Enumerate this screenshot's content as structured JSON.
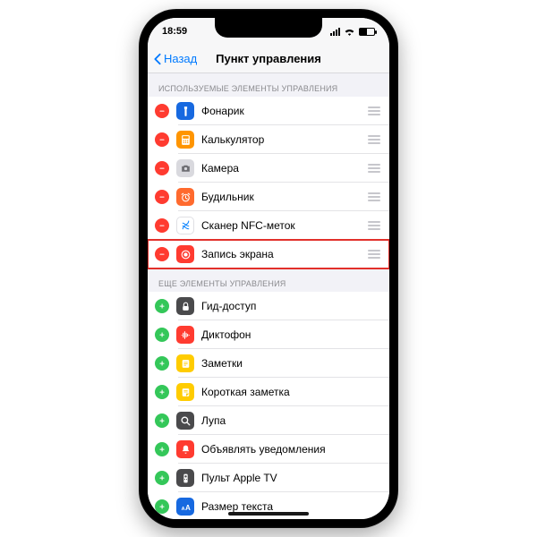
{
  "status": {
    "time": "18:59"
  },
  "nav": {
    "back": "Назад",
    "title": "Пункт управления"
  },
  "section_included": "ИСПОЛЬЗУЕМЫЕ ЭЛЕМЕНТЫ УПРАВЛЕНИЯ",
  "section_more": "ЕЩЕ ЭЛЕМЕНТЫ УПРАВЛЕНИЯ",
  "included": [
    {
      "label": "Фонарик",
      "icon_bg": "#1769e0",
      "glyph": "flashlight"
    },
    {
      "label": "Калькулятор",
      "icon_bg": "#ff9500",
      "glyph": "calculator"
    },
    {
      "label": "Камера",
      "icon_bg": "#d9d9de",
      "glyph": "camera"
    },
    {
      "label": "Будильник",
      "icon_bg": "#ff6a2e",
      "glyph": "alarm"
    },
    {
      "label": "Сканер NFC-меток",
      "icon_bg": "#ffffff",
      "glyph": "nfc"
    },
    {
      "label": "Запись экрана",
      "icon_bg": "#ff3b30",
      "glyph": "record",
      "highlight": true
    }
  ],
  "more": [
    {
      "label": "Гид-доступ",
      "icon_bg": "#4a4a4c",
      "glyph": "lock"
    },
    {
      "label": "Диктофон",
      "icon_bg": "#ff3b30",
      "glyph": "wave"
    },
    {
      "label": "Заметки",
      "icon_bg": "#ffcc00",
      "glyph": "note"
    },
    {
      "label": "Короткая заметка",
      "icon_bg": "#ffcc00",
      "glyph": "quicknote"
    },
    {
      "label": "Лупа",
      "icon_bg": "#4a4a4c",
      "glyph": "magnifier"
    },
    {
      "label": "Объявлять уведомления",
      "icon_bg": "#ff3b30",
      "glyph": "bell"
    },
    {
      "label": "Пульт Apple TV",
      "icon_bg": "#4a4a4c",
      "glyph": "remote"
    },
    {
      "label": "Размер текста",
      "icon_bg": "#1769e0",
      "glyph": "textsize"
    }
  ]
}
